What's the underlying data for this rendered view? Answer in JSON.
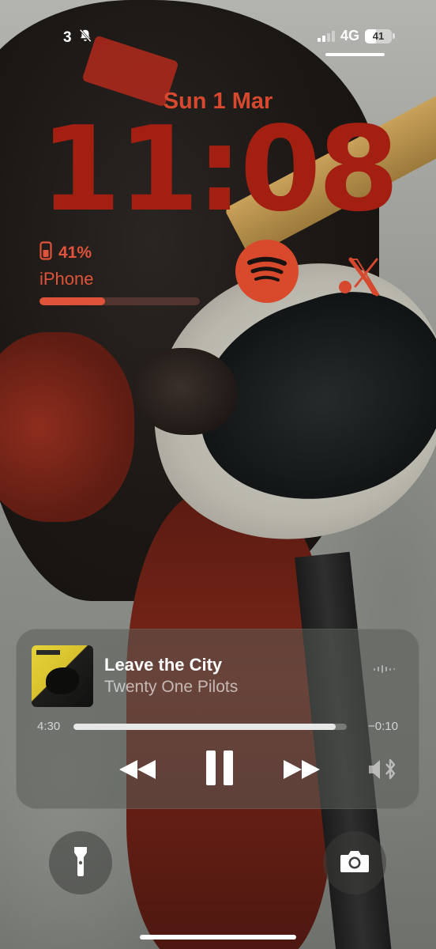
{
  "status_bar": {
    "notification_count": "3",
    "network": "4G",
    "battery_level": "41",
    "battery_fraction": 0.41
  },
  "lock_screen": {
    "date": "Sun 1 Mar",
    "time": "11:08"
  },
  "widgets": {
    "battery": {
      "percent": "41%",
      "device": "iPhone",
      "fraction": 0.41,
      "icon": "phone-battery-icon"
    },
    "spotify": {
      "icon": "spotify-icon"
    },
    "x_app": {
      "icon": "x-logo-icon"
    }
  },
  "now_playing": {
    "title": "Leave the City",
    "artist": "Twenty One Pilots",
    "elapsed": "4:30",
    "remaining": "−0:10",
    "progress_fraction": 0.96,
    "controls": [
      "rewind-icon",
      "pause-icon",
      "fast-forward-icon",
      "airplay-audio-icon"
    ]
  },
  "quick_actions": {
    "left_icon": "flashlight-icon",
    "right_icon": "camera-icon"
  },
  "colors": {
    "accent": "#d6492f",
    "clock": "#a31f12"
  }
}
